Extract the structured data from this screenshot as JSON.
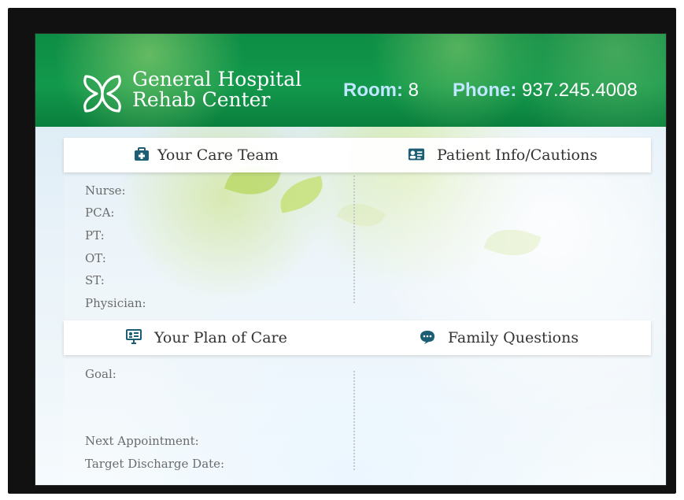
{
  "brand": {
    "line1": "General Hospital",
    "line2": "Rehab Center"
  },
  "header": {
    "room_label": "Room:",
    "room_value": "8",
    "phone_label": "Phone:",
    "phone_value": "937.245.4008"
  },
  "sections": {
    "care_team": {
      "title": "Your Care Team",
      "icon": "first-aid-kit-icon",
      "fields": [
        "Nurse:",
        "PCA:",
        "PT:",
        "OT:",
        "ST:",
        "Physician:"
      ]
    },
    "patient_info": {
      "title": "Patient Info/Cautions",
      "icon": "id-card-icon"
    },
    "plan_of_care": {
      "title": "Your Plan of Care",
      "icon": "presentation-board-icon",
      "fields": [
        "Goal:",
        "Next Appointment:",
        "Target Discharge Date:"
      ]
    },
    "family_questions": {
      "title": "Family Questions",
      "icon": "speech-bubble-icon"
    }
  },
  "colors": {
    "header_green": "#12994c",
    "accent_teal": "#1c5e73",
    "label_gray": "#6b6b6b"
  }
}
